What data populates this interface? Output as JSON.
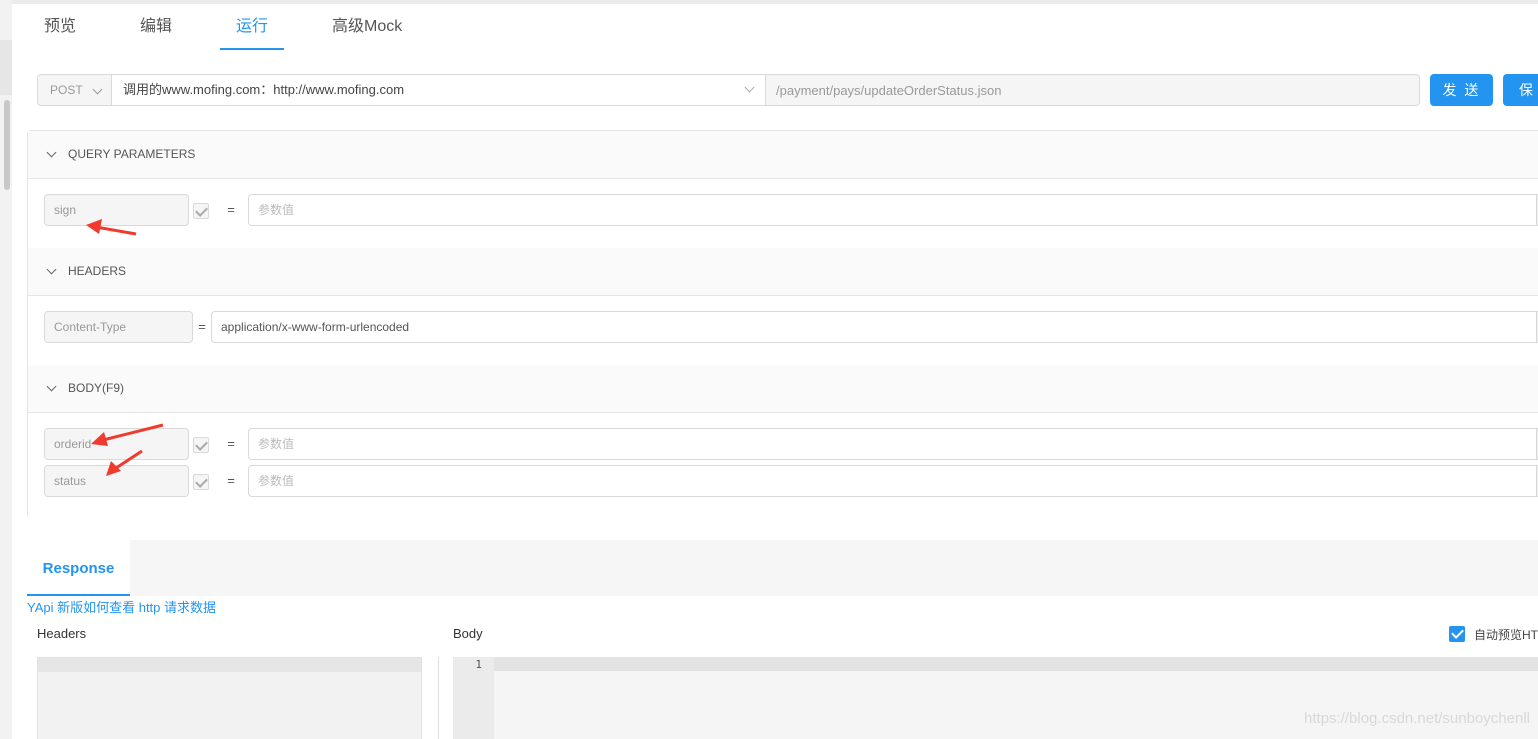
{
  "tabs": [
    "预览",
    "编辑",
    "运行",
    "高级Mock"
  ],
  "active_tab": "运行",
  "request": {
    "method": "POST",
    "env": "调用的www.mofing.com：http://www.mofing.com",
    "path": "/payment/pays/updateOrderStatus.json",
    "send_label": "发 送",
    "save_label": "保"
  },
  "sections": {
    "query": {
      "title": "QUERY PARAMETERS",
      "params": [
        {
          "name": "sign",
          "equals": "=",
          "placeholder": "参数值",
          "checked": true
        }
      ]
    },
    "headers": {
      "title": "HEADERS",
      "params": [
        {
          "name": "Content-Type",
          "equals": "=",
          "value": "application/x-www-form-urlencoded"
        }
      ]
    },
    "body": {
      "title": "BODY(F9)",
      "params": [
        {
          "name": "orderid",
          "equals": "=",
          "placeholder": "参数值",
          "checked": true
        },
        {
          "name": "status",
          "equals": "=",
          "placeholder": "参数值",
          "checked": true
        }
      ]
    }
  },
  "response": {
    "tab": "Response",
    "help_link": "YApi 新版如何查看 http 请求数据",
    "headers_label": "Headers",
    "body_label": "Body",
    "auto_preview_label": "自动预览HTML",
    "auto_preview_checked": true,
    "line_number": "1"
  },
  "watermark": "https://blog.csdn.net/sunboychenll",
  "colors": {
    "accent": "#2395f1",
    "annotation_arrow": "#f03a2e"
  },
  "icons": {
    "section_toggle": "chevron-down-icon",
    "select_toggle": "chevron-down-icon",
    "enabled": "check-icon"
  }
}
